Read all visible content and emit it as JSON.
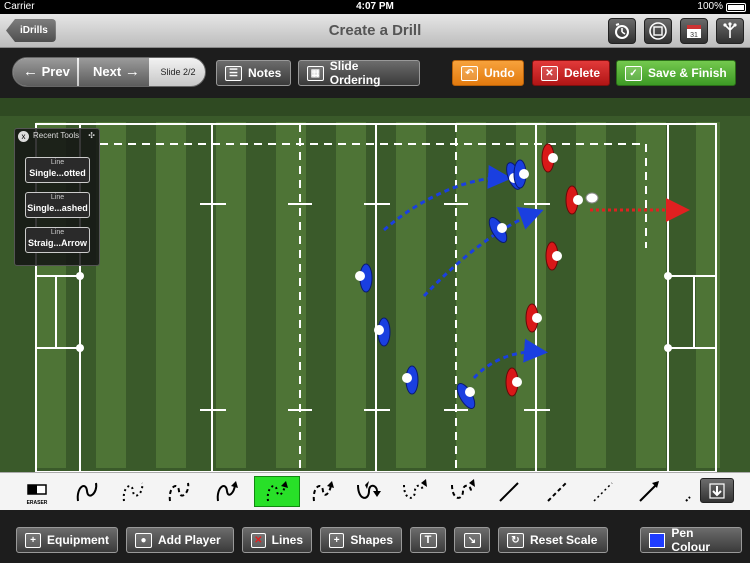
{
  "status": {
    "carrier": "Carrier",
    "time": "4:07 PM",
    "battery": "100%"
  },
  "header": {
    "back_label": "iDrills",
    "title": "Create a Drill"
  },
  "toolbar": {
    "prev_label": "Prev",
    "next_label": "Next",
    "slide_label": "Slide 2/2",
    "notes_label": "Notes",
    "slide_ordering_label": "Slide Ordering",
    "undo_label": "Undo",
    "delete_label": "Delete",
    "save_label": "Save & Finish"
  },
  "recent_tools": {
    "title": "Recent Tools",
    "items": [
      {
        "type": "Line",
        "name": "Single...otted"
      },
      {
        "type": "Line",
        "name": "Single...ashed"
      },
      {
        "type": "Line",
        "name": "Straig...Arrow"
      }
    ]
  },
  "line_picker": {
    "eraser_label": "ERASER"
  },
  "bottom": {
    "equipment_label": "Equipment",
    "add_player_label": "Add Player",
    "lines_label": "Lines",
    "shapes_label": "Shapes",
    "text_label": "T",
    "reset_scale_label": "Reset Scale",
    "pen_colour_label": "Pen Colour"
  },
  "colors": {
    "team_blue": "#1a3fe0",
    "team_red": "#d81818",
    "pen_colour": "#1e3cff",
    "active_tool": "#28e028"
  }
}
